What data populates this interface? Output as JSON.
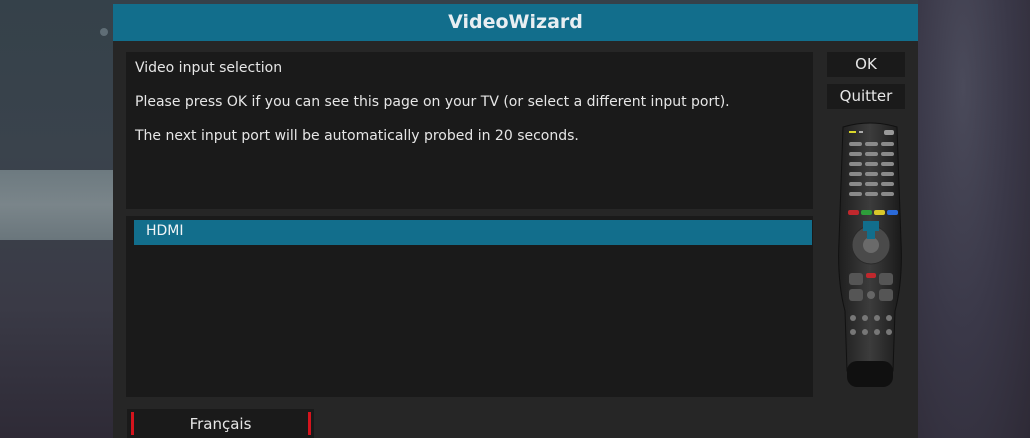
{
  "window": {
    "title": "VideoWizard"
  },
  "message": {
    "heading": "Video input selection",
    "line1": "Please press OK if you can see this page on your TV (or select a different input port).",
    "line2": "The next input port will be automatically probed in 20 seconds."
  },
  "input_list": {
    "items": [
      "HDMI"
    ],
    "selected": "HDMI"
  },
  "buttons": {
    "ok_label": "OK",
    "quit_label": "Quitter",
    "language_label": "Français"
  },
  "remote": {
    "icon": "remote-control-icon",
    "highlighted_key": "OK"
  },
  "colors": {
    "accent": "#126e8c",
    "red_marker": "#d4141d",
    "panel": "#1a1a1a",
    "window": "#262626"
  }
}
